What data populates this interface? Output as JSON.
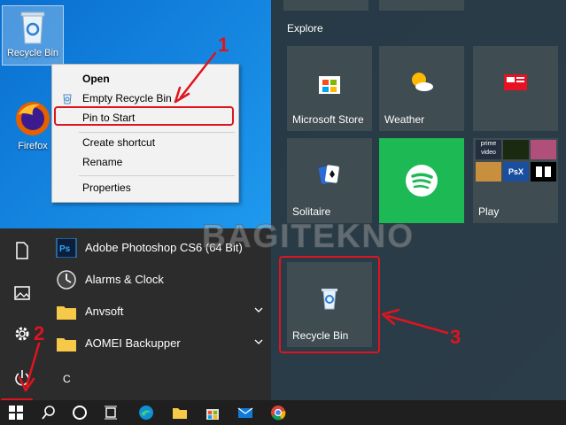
{
  "desktop": {
    "recycle_bin_label": "Recycle Bin",
    "firefox_label": "Firefox"
  },
  "context_menu": {
    "items": [
      {
        "label": "Open",
        "bold": true
      },
      {
        "label": "Empty Recycle Bin"
      },
      {
        "label": "Pin to Start"
      },
      {
        "label": "Create shortcut"
      },
      {
        "label": "Rename"
      },
      {
        "label": "Properties"
      }
    ]
  },
  "start_menu": {
    "explore_label": "Explore",
    "apps": [
      {
        "label": "Adobe Photoshop CS6 (64 Bit)",
        "icon": "photoshop-icon"
      },
      {
        "label": "Alarms & Clock",
        "icon": "clock-icon"
      },
      {
        "label": "Anvsoft",
        "icon": "folder-icon",
        "expandable": true
      },
      {
        "label": "AOMEI Backupper",
        "icon": "folder-icon",
        "expandable": true
      }
    ],
    "letter_header": "C",
    "tiles": {
      "microsoft_store": "Microsoft Store",
      "weather": "Weather",
      "solitaire": "Solitaire",
      "play": "Play",
      "recycle_bin": "Recycle Bin"
    },
    "play_grid_labels": [
      "prime video",
      "PsX"
    ]
  },
  "watermark": "BAGITEKNO",
  "annotations": {
    "step1": "1",
    "step2": "2",
    "step3": "3"
  },
  "colors": {
    "annotation_red": "#e0141e",
    "spotify_green": "#1db954",
    "tile_bg": "#3f4c52"
  }
}
